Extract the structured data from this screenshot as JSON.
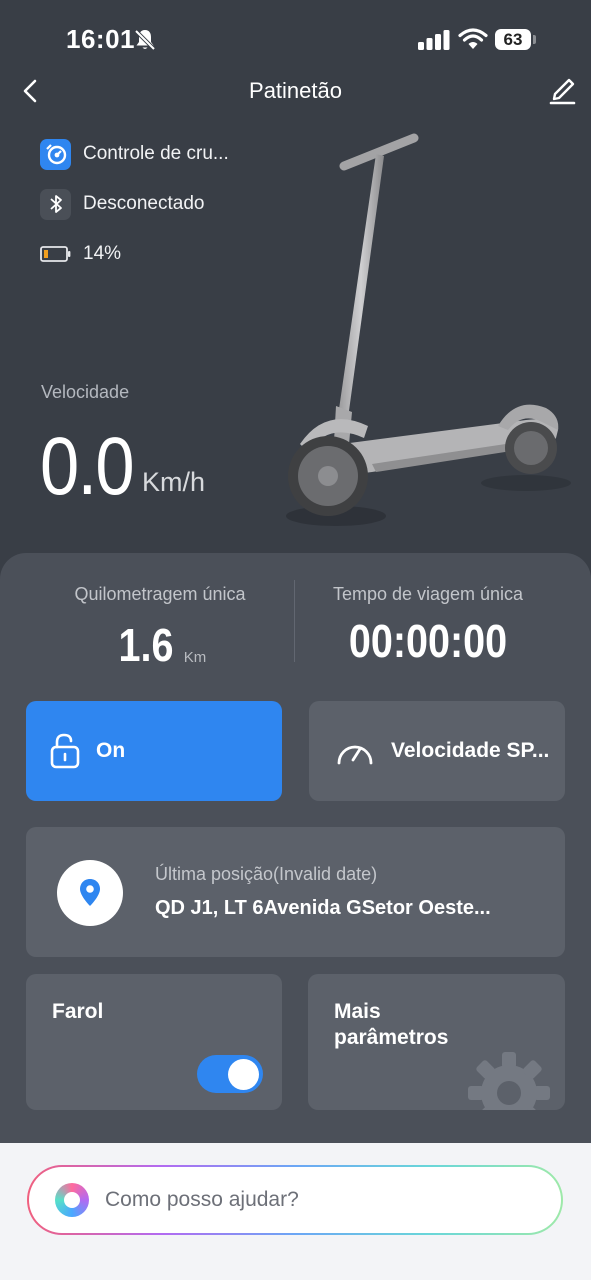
{
  "status_bar": {
    "time": "16:01",
    "battery": "63",
    "icons": [
      "bell-off-icon",
      "signal-icon",
      "wifi-icon",
      "battery-icon"
    ]
  },
  "header": {
    "title": "Patinetão",
    "icons": [
      "back-chevron-icon",
      "edit-icon"
    ]
  },
  "info": {
    "cruise": "Controle de cru...",
    "bluetooth": "Desconectado",
    "battery_level": "14%",
    "icons": [
      "cruise-control-icon",
      "bluetooth-icon",
      "low-battery-icon"
    ]
  },
  "speed": {
    "label": "Velocidade",
    "value": "0.0",
    "unit": "Km/h"
  },
  "stats": {
    "mileage_label": "Quilometragem única",
    "mileage_value": "1.6",
    "mileage_unit": "Km",
    "time_label": "Tempo de viagem única",
    "time_value": "00:00:00"
  },
  "tiles": {
    "lock_label": "On",
    "speed_mode_label": "Velocidade SP...",
    "location_title": "Última posição(Invalid date)",
    "location_address": "QD J1, LT 6Avenida GSetor Oeste...",
    "headlight_label": "Farol",
    "headlight_on": true,
    "more_params_line1": "Mais",
    "more_params_line2": "parâmetros",
    "icons": [
      "unlock-icon",
      "speedometer-icon",
      "location-pin-icon",
      "gear-icon"
    ]
  },
  "assistant": {
    "placeholder": "Como posso ajudar?"
  },
  "colors": {
    "background": "#393e46",
    "card_area": "#4b5059",
    "tile": "#5c616a",
    "accent": "#2f86f0"
  }
}
